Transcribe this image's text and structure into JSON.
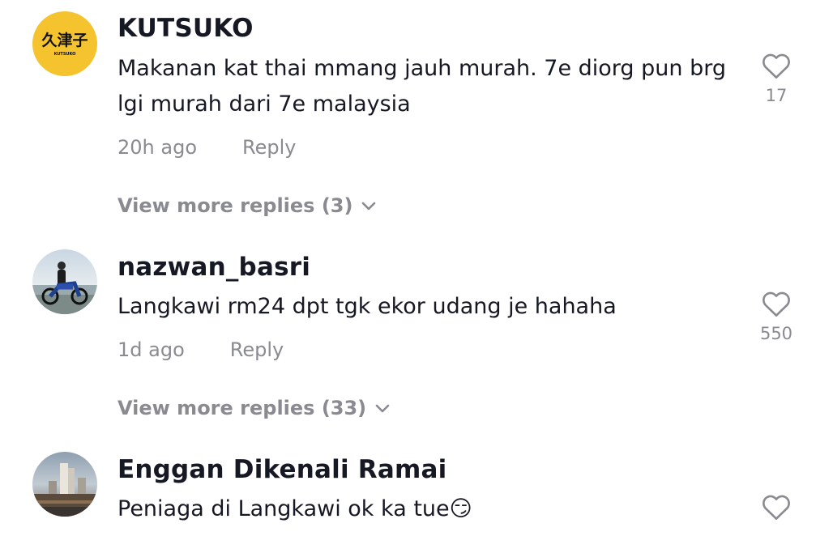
{
  "comments": [
    {
      "username": "KUTSUKO",
      "avatar_text": "久津子",
      "avatar_subtext": "KUTSUKO",
      "text": "Makanan kat thai mmang jauh murah. 7e diorg pun brg lgi murah dari 7e malaysia",
      "time": "20h ago",
      "reply": "Reply",
      "likes": "17",
      "more_replies": "View more replies (3)"
    },
    {
      "username": "nazwan_basri",
      "text": "Langkawi rm24 dpt tgk ekor udang je hahaha",
      "time": "1d ago",
      "reply": "Reply",
      "likes": "550",
      "more_replies": "View more replies (33)"
    },
    {
      "username": "Enggan Dikenali Ramai",
      "text": "Peniaga di Langkawi ok ka tue😏"
    }
  ],
  "icons": {
    "like": "heart-outline-icon",
    "expand": "chevron-down-icon"
  },
  "colors": {
    "primary_text": "#161823",
    "secondary_text": "#8a8b91",
    "kutsuko_avatar_bg": "#f5c32e"
  }
}
